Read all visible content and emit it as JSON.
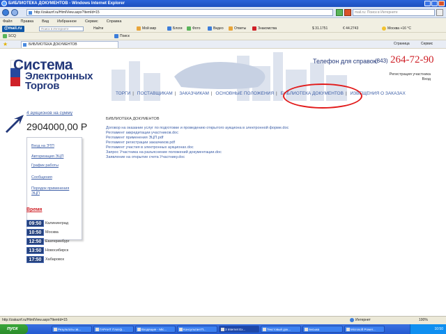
{
  "window": {
    "title": "БИБЛИОТЕКА ДОКУМЕНТОВ - Windows Internet Explorer"
  },
  "address": {
    "url": "http://zakazrf.ru/HtmlView.aspx?ItemId=15",
    "search_placeholder": "mail.ru: Поиск в Интернете"
  },
  "menu": [
    "Файл",
    "Правка",
    "Вид",
    "Избранное",
    "Сервис",
    "Справка"
  ],
  "toolbar1": {
    "logo": "@mail.ru",
    "search_placeholder": "Поиск в Интернете",
    "find": "Найти",
    "items": [
      "Мой мир",
      "Блоги",
      "Фото",
      "Видео",
      "Ответы",
      "Знакомства"
    ],
    "rate_usd": "$ 31.1751",
    "rate_eur": "€ 44.2743",
    "weather": "Москва +16 °C"
  },
  "toolbar2": {
    "label": "SCQ",
    "search": "Поиск"
  },
  "toolbar3": {
    "tab_title": "БИБЛИОТЕКА ДОКУМЕНТОВ",
    "page_menu": "Страница",
    "tools_menu": "Сервис"
  },
  "header": {
    "logo_line1": "Система",
    "logo_line2": "Электронных",
    "logo_line3": "Торгов",
    "phone_label": "Телефон для справок:",
    "phone_code": "(843)",
    "phone_number": "264-72-90",
    "register": "Регистрация участника",
    "login": "Вход"
  },
  "nav": {
    "items": [
      "ТОРГИ",
      "ПОСТАВЩИКАМ",
      "ЗАКАЗЧИКАМ",
      "ОСНОВНЫЕ ПОЛОЖЕНИЯ",
      "БИБЛИОТЕКА ДОКУМЕНТОВ",
      "ИЗВЕЩЕНИЯ О ЗАКАЗАХ"
    ],
    "highlight_color": "#e21a1a"
  },
  "sidebar": {
    "auction_link": "4 аукционов на сумму",
    "amount": "2904000,00 Р",
    "links": [
      "Вход на ЭТП",
      "Авторизация ЭЦП",
      "График работы",
      "Сообщения",
      "Порядок применения ЭЦП"
    ],
    "time_title": "Время",
    "times": [
      {
        "time": "09:50",
        "city": "Калининград"
      },
      {
        "time": "10:50",
        "city": "Москва"
      },
      {
        "time": "12:50",
        "city": "Екатеринбург"
      },
      {
        "time": "13:50",
        "city": "Новосибирск"
      },
      {
        "time": "17:50",
        "city": "Хабаровск"
      }
    ]
  },
  "library": {
    "title": "БИБЛИОТЕКА ДОКУМЕНТОВ",
    "documents": [
      "Договор на оказание услуг по подготовке и проведению открытого аукциона в электронной форме.doc",
      "Регламент аккредитации участников.doc",
      "Регламент применения ЭЦП.pdf",
      "Регламент регистрации заказчиков.pdf",
      "Регламент участия в электронных аукционах.doc",
      "Запрос Участника на разъяснение положений документации.doc",
      "Заявление на открытие счета Участнику.doc"
    ]
  },
  "status": {
    "url": "http://zakazrf.ru/HtmlView.aspx?ItemId=15",
    "zone": "Интернет",
    "zoom": "100%"
  },
  "taskbar": {
    "start": "пуск",
    "items": [
      "Результаты зв...",
      "ГАРАНТ Платф...",
      "Входящие - Mic...",
      "КонсультантП...",
      "3 Internet Ex...",
      "Текстовый док...",
      "письма",
      "Microsoft Power..."
    ],
    "clock": "10:50"
  }
}
